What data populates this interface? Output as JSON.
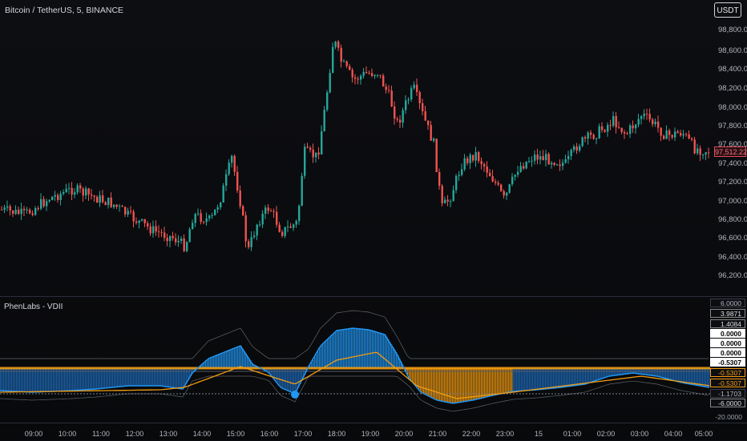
{
  "header": {
    "title": "Bitcoin / TetherUS, 5, BINANCE",
    "currency": "USDT"
  },
  "price_axis": [
    "98,800.00",
    "98,600.00",
    "98,400.00",
    "98,200.00",
    "98,000.00",
    "97,800.00",
    "97,600.00",
    "97,400.00",
    "97,200.00",
    "97,000.00",
    "96,800.00",
    "96,600.00",
    "96,400.00",
    "96,200.00"
  ],
  "last_price": "97,512.22",
  "indicator": {
    "title": "PhenLabs - VDII",
    "labels": [
      "6.0000",
      "3.9871",
      "1.4084",
      "0.0000",
      "0.0000",
      "0.0000",
      "-0.5307",
      "-0.5307",
      "-0.5307",
      "-1.1703",
      "-6.0000",
      "-20.0000"
    ]
  },
  "time_axis": [
    "09:00",
    "10:00",
    "11:00",
    "12:00",
    "13:00",
    "14:00",
    "15:00",
    "16:00",
    "17:00",
    "18:00",
    "19:00",
    "20:00",
    "21:00",
    "22:00",
    "23:00",
    "15",
    "01:00",
    "02:00",
    "03:00",
    "04:00",
    "05:00"
  ],
  "colors": {
    "up": "#26a69a",
    "down": "#ef5350",
    "blue": "#2196f3",
    "orange": "#f39c12"
  }
}
